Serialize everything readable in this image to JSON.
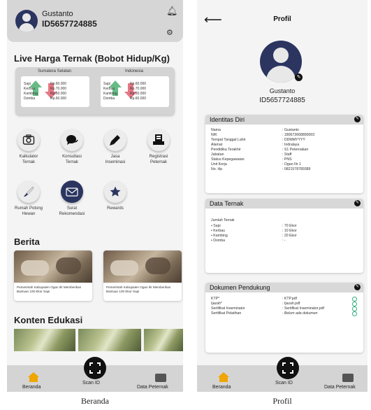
{
  "user": {
    "name": "Gustanto",
    "id": "ID5657724885"
  },
  "home": {
    "price_title": "Live Harga Ternak (Bobot Hidup/Kg)",
    "regions": [
      {
        "name": "Sumatera Selatan",
        "rows": [
          {
            "label": "Sapi",
            "value": "Rp.60.000"
          },
          {
            "label": "Kerbau",
            "value": "Rp.70.000"
          },
          {
            "label": "Kambing",
            "value": "Rp.50.000"
          },
          {
            "label": "Domba",
            "value": "Rp.60.000"
          }
        ]
      },
      {
        "name": "Indonesia",
        "rows": [
          {
            "label": "Sapi",
            "value": "Rp.60.000"
          },
          {
            "label": "Kerbau",
            "value": "Rp.70.000"
          },
          {
            "label": "Kambing",
            "value": "Rp.50.000"
          },
          {
            "label": "Domba",
            "value": "Rp.60.000"
          }
        ]
      }
    ],
    "menu": [
      {
        "line1": "Kalkulator",
        "line2": "Ternak",
        "icon": "camera-icon"
      },
      {
        "line1": "Konsultasi",
        "line2": "Ternak",
        "icon": "chat-icon"
      },
      {
        "line1": "Jasa",
        "line2": "Inseminasi",
        "icon": "syringe-icon"
      },
      {
        "line1": "Registrasi",
        "line2": "Peternak",
        "icon": "register-icon"
      },
      {
        "line1": "Rumah Potong",
        "line2": "Hewan",
        "icon": "knife-icon"
      },
      {
        "line1": "Surat",
        "line2": "Rekomendasi",
        "icon": "mail-icon"
      },
      {
        "line1": "Rewards",
        "line2": "",
        "icon": "star-icon"
      }
    ],
    "news_title": "Berita",
    "news": [
      {
        "text": "Pemerintah Kabupaten Ogan Ilir Memberikan Bantuan 100 Ekor Sapi"
      },
      {
        "text": "Pemerintah Kabupaten Ogan Ilir Memberikan Bantuan 100 Ekor Sapi"
      }
    ],
    "edu_title": "Konten Edukasi",
    "caption": "Beranda"
  },
  "nav": {
    "home": "Beranda",
    "scan": "Scan ID",
    "data": "Data Peternak"
  },
  "profile": {
    "title": "Profil",
    "caption": "Profil",
    "identity": {
      "title": "Identitas Diri",
      "rows": [
        {
          "k": "Nama",
          "v": ": Gustanto"
        },
        {
          "k": "NIK",
          "v": ": 180673668890003"
        },
        {
          "k": "Tempat Tanggal Lahir",
          "v": ": DDMMYYYY"
        },
        {
          "k": "Alamat",
          "v": ": Indralaya"
        },
        {
          "k": "Pendidika Terakhir",
          "v": ": S1 Peternakan"
        },
        {
          "k": "Jabatan",
          "v": ": Staff"
        },
        {
          "k": "Status Kepegawaian",
          "v": ": PNS"
        },
        {
          "k": "Unit Kerja",
          "v": ": Ogan Ilir 1"
        },
        {
          "k": "No. Hp",
          "v": ": 0821578789389"
        }
      ]
    },
    "livestock": {
      "title": "Data Ternak",
      "subtitle": "Jumlah Ternak",
      "rows": [
        {
          "k": "• Sapi",
          "v": ": 70 Ekor"
        },
        {
          "k": "• Kerbau",
          "v": ": 10 Ekor"
        },
        {
          "k": "• Kambing",
          "v": ": 20 Ekor"
        },
        {
          "k": "• Domba",
          "v": ": -"
        }
      ]
    },
    "documents": {
      "title": "Dokumen Pendukung",
      "rows": [
        {
          "k": "KTP*",
          "v": ": KTP.pdf"
        },
        {
          "k": "Ijazah*",
          "v": ": Ijazah.pdf"
        },
        {
          "k": "Sertifikat Inseminator",
          "v": ": Sertifikat Inseminator.pdf"
        },
        {
          "k": "Sertifikat Pelatihan",
          "v": ": Belum ada dokumen"
        }
      ]
    }
  },
  "colors": {
    "navy": "#2b3560",
    "up": "#4caf70",
    "down": "#e06070",
    "home": "#f0a500",
    "check": "#2fae7b"
  }
}
